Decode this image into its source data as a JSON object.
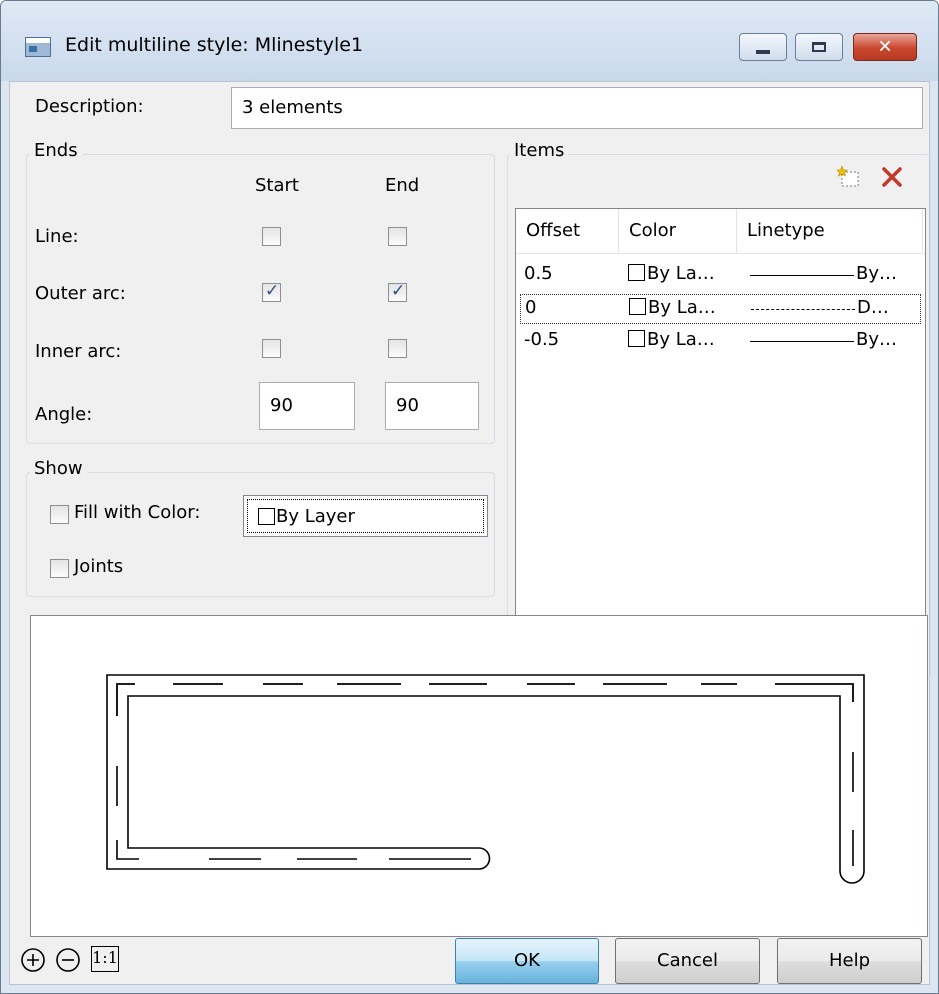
{
  "window": {
    "title": "Edit multiline style: Mlinestyle1",
    "app_icon": "window-app-icon",
    "controls": {
      "minimize": "minimize-icon",
      "maximize": "maximize-icon",
      "close": "✕"
    }
  },
  "description": {
    "label": "Description:",
    "value": "3 elements"
  },
  "ends": {
    "title": "Ends",
    "col_start": "Start",
    "col_end": "End",
    "rows": [
      {
        "label": "Line:",
        "start": false,
        "end": false
      },
      {
        "label": "Outer arc:",
        "start": true,
        "end": true
      },
      {
        "label": "Inner arc:",
        "start": false,
        "end": false
      }
    ],
    "angle": {
      "label": "Angle:",
      "start": "90",
      "end": "90"
    }
  },
  "show": {
    "title": "Show",
    "fill_label": "Fill with Color:",
    "fill_checked": false,
    "fill_color": "By Layer",
    "joints_label": "Joints",
    "joints_checked": false
  },
  "items": {
    "title": "Items",
    "add_icon": "new-item-icon",
    "delete_icon": "delete-item-icon",
    "columns": [
      "Offset",
      "Color",
      "Linetype"
    ],
    "rows": [
      {
        "offset": "0.5",
        "color": "By La…",
        "linetype": "By…",
        "style": "continuous"
      },
      {
        "offset": "0",
        "color": "By La…",
        "linetype": "D…",
        "style": "dashed"
      },
      {
        "offset": "-0.5",
        "color": "By La…",
        "linetype": "By…",
        "style": "continuous"
      }
    ]
  },
  "footer": {
    "zoom_in": "zoom-in-icon",
    "zoom_out": "zoom-out-icon",
    "zoom_reset": "1:1",
    "ok": "OK",
    "cancel": "Cancel",
    "help": "Help"
  },
  "colors": {
    "accent": "#c0392b",
    "close_button": "#c9462c",
    "default_button": "#98d1ef"
  }
}
